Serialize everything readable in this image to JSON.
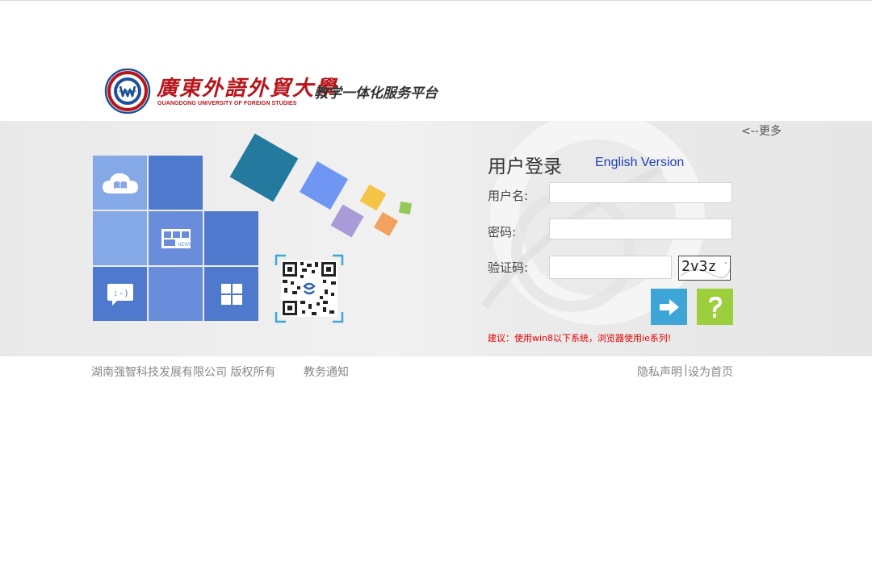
{
  "header": {
    "university_cn": "廣東外語外貿大學",
    "university_en": "GUANGDONG UNIVERSITY OF FOREIGN STUDIES",
    "platform_title": "教学一体化服务平台"
  },
  "banner": {
    "more_link": "<--更多",
    "tiles": [
      {
        "icon": "cloud-book-icon"
      },
      {
        "icon": "news-icon",
        "label": "NEWS"
      },
      {
        "icon": "chat-icon",
        "label": ":-)"
      },
      {
        "icon": "grid-icon"
      }
    ]
  },
  "login": {
    "title": "用户登录",
    "english_version": "English Version",
    "username_label": "用户名:",
    "username_value": "",
    "password_label": "密码:",
    "password_value": "",
    "captcha_label": "验证码:",
    "captcha_value": "",
    "captcha_image_text": "2v3z",
    "login_icon": "arrow-right-icon",
    "help_icon": "question-icon",
    "tip": "建议：使用win8以下系统，浏览器使用ie系列!"
  },
  "footer": {
    "copyright": "湖南强智科技发展有限公司 版权所有",
    "notice": "教务通知",
    "privacy": "隐私声明",
    "separator": "|",
    "set_homepage": "设为首页"
  },
  "colors": {
    "brand_red": "#b8151b",
    "tile_light": "#85a8e6",
    "tile_mid": "#6a8ddb",
    "tile_dark": "#4e79cc",
    "login_button": "#3ea5d8",
    "help_button": "#9bcf3c",
    "tip_red": "#e60000",
    "english_link": "#1e3fb8"
  }
}
